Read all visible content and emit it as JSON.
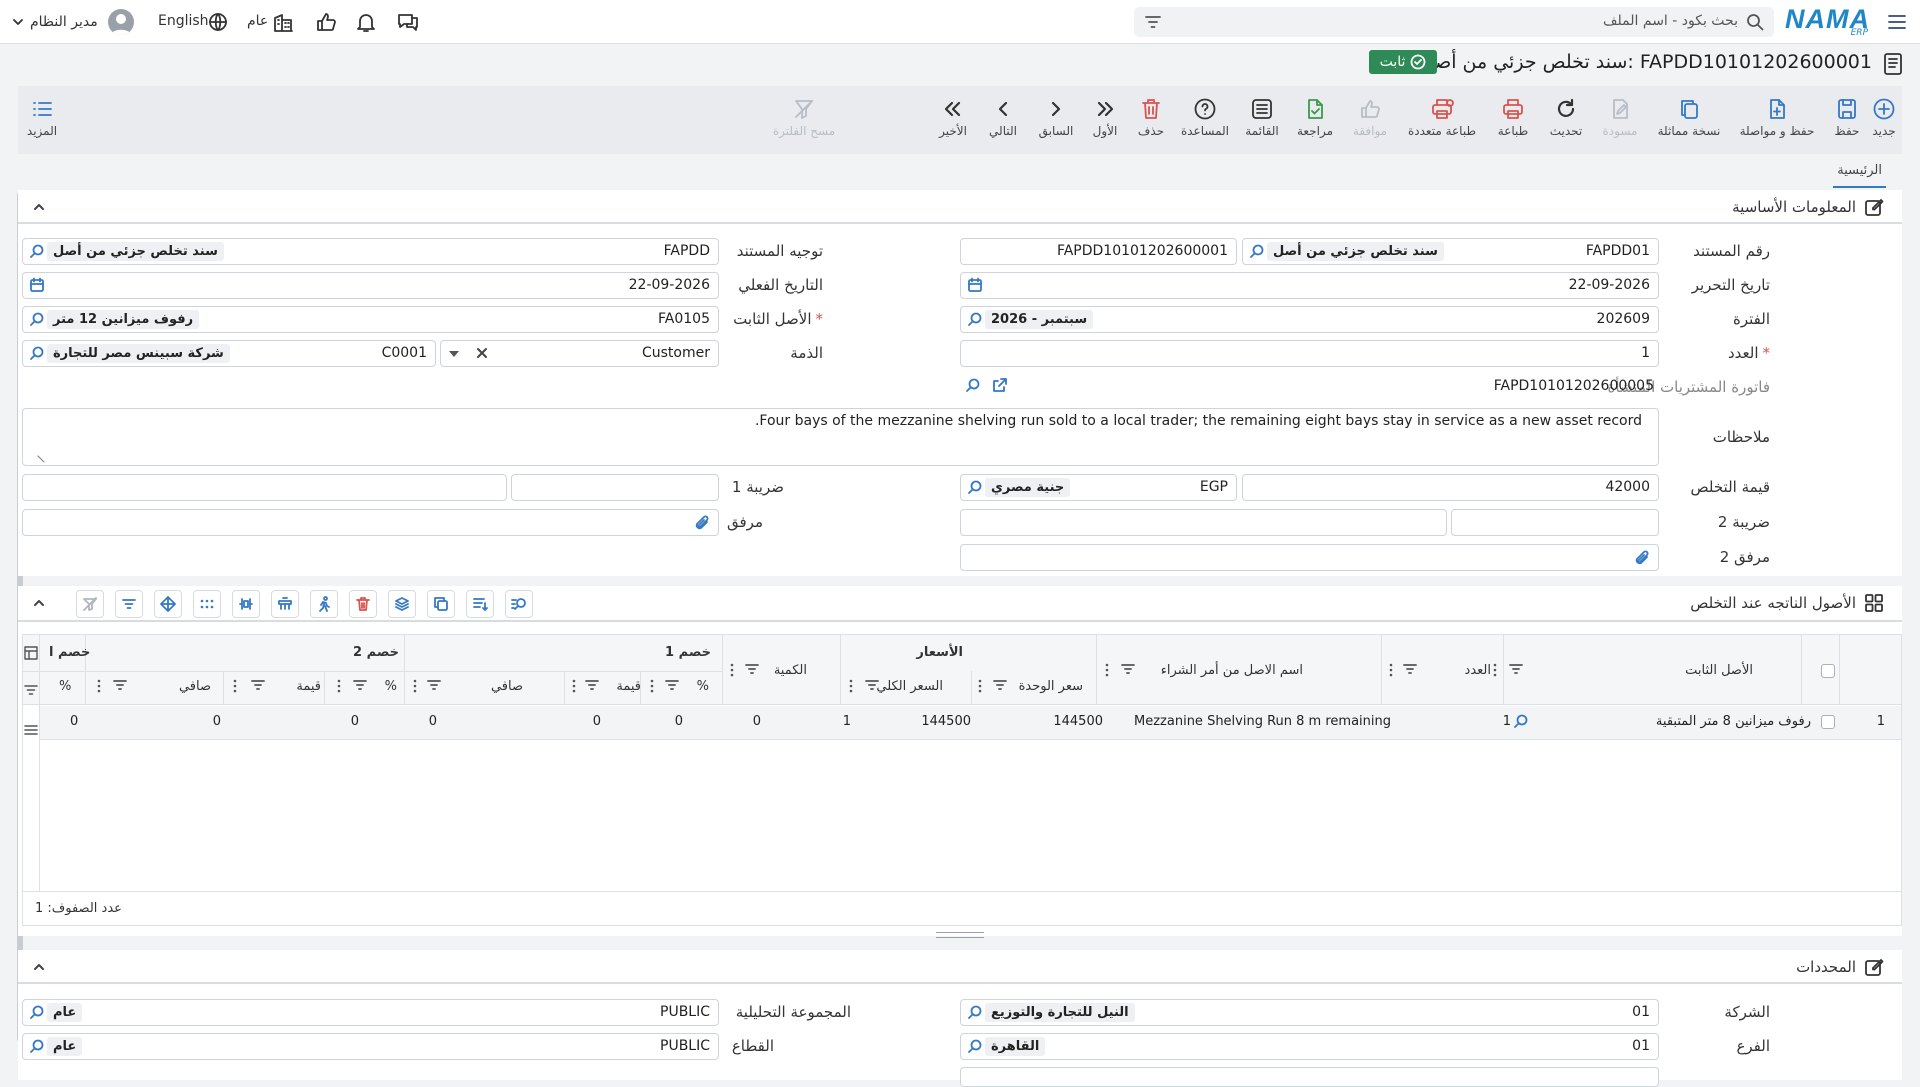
{
  "topbar": {
    "search_placeholder": "بحث بكود - اسم الملف",
    "brand": "NAMA",
    "brand_sub": "ERP",
    "user": "مدير النظام",
    "lang": "English",
    "scope": "عام"
  },
  "title": {
    "text": "سند تخلص جزئي من أصل: FAPDD10101202600001",
    "status": "ثابت"
  },
  "toolbar": {
    "new": "جديد",
    "save": "حفظ",
    "save_continue": "حفظ و مواصلة",
    "duplicate": "نسخة مماثلة",
    "draft": "مسودة",
    "refresh": "تحديث",
    "print": "طباعة",
    "multi_print": "طباعة متعددة",
    "approve": "موافقة",
    "review": "مراجعة",
    "list": "القائمة",
    "help": "المساعدة",
    "delete": "حذف",
    "first": "الأول",
    "prev": "السابق",
    "next": "التالي",
    "last": "الأخير",
    "clear_filter": "مسح الفلترة",
    "more": "المزيد"
  },
  "tabs": {
    "main": "الرئيسية"
  },
  "basic": {
    "title": "المعلومات الأساسية",
    "doc_no_label": "رقم المستند",
    "doc_no_code": "FAPDD01",
    "doc_no_name": "سند تخلص جزئي من أصل",
    "doc_no_full": "FAPDD10101202600001",
    "doc_dir_label": "توجيه المستند",
    "doc_dir_code": "FAPDD",
    "doc_dir_name": "سند تخلص جزئي من أصل",
    "edit_date_label": "تاريخ التحرير",
    "edit_date": "22-09-2026",
    "actual_date_label": "التاريخ الفعلي",
    "actual_date": "22-09-2026",
    "period_label": "الفترة",
    "period_code": "202609",
    "period_name": "2026 - سبتمبر",
    "asset_label": "الأصل الثابت",
    "asset_code": "FA0105",
    "asset_name": "رفوف ميزانين 12 متر",
    "count_label": "العدد",
    "count": "1",
    "account_label": "الذمة",
    "account_type": "Customer",
    "account_code": "C0001",
    "account_name": "شركة سبينس مصر للتجارة",
    "invoice_label": "فاتورة المشتريات المنشأة",
    "invoice": "FAPD10101202600005",
    "notes_label": "ملاحظات",
    "notes": "Four bays of the mezzanine shelving run sold to a local trader; the remaining eight bays stay in service as a new asset record.",
    "disposal_label": "قيمة التخلص",
    "disposal_value": "42000",
    "currency_code": "EGP",
    "currency_name": "جنية مصري",
    "tax1_label": "ضريبة 1",
    "tax2_label": "ضريبة 2",
    "attach_label": "مرفق",
    "attach2_label": "مرفق 2"
  },
  "assets": {
    "title": "الأصول الناتجه عند التخلص",
    "headers": {
      "asset": "الأصل الثابت",
      "count": "العدد",
      "po_name": "اسم الاصل من أمر الشراء",
      "prices": "الأسعار",
      "unit_price": "سعر الوحدة",
      "total_price": "السعر الكلي",
      "qty": "الكمية",
      "disc1": "خصم 1",
      "disc2": "خصم 2",
      "disc3": "خصم ا",
      "pct": "%",
      "value": "قيمة",
      "net": "صافي"
    },
    "rows": [
      {
        "no": "1",
        "asset": "رفوف ميزانين 8 متر المتبقية",
        "count": "1",
        "po_name": "Mezzanine Shelving Run 8 m remaining",
        "unit_price": "144500",
        "total_price": "144500",
        "qty": "1",
        "d1_pct": "0",
        "d1_val": "0",
        "d1_net": "0",
        "d2_pct": "0",
        "d2_val": "0",
        "d2_net": "0",
        "d3_pct": "0"
      }
    ],
    "row_count": "عدد الصفوف: 1"
  },
  "determinants": {
    "title": "المحددات",
    "company_label": "الشركة",
    "company_code": "01",
    "company_name": "النيل للتجارة والتوزيع",
    "branch_label": "الفرع",
    "branch_code": "01",
    "branch_name": "القاهرة",
    "analytic_label": "المجموعة التحليلية",
    "analytic_code": "PUBLIC",
    "analytic_name": "عام",
    "sector_label": "القطاع",
    "sector_code": "PUBLIC",
    "sector_name": "عام"
  },
  "colors": {
    "accent": "#3478c6",
    "status_green": "#2e8b57",
    "danger": "#d9534f"
  }
}
